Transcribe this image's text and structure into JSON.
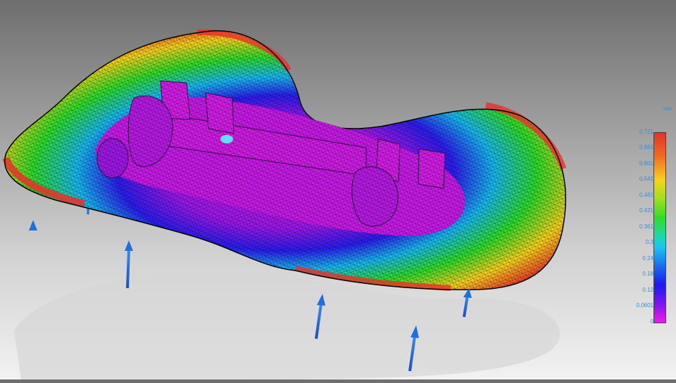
{
  "viewport": {
    "description_name": "fea-result-view",
    "colors": {
      "background_top": "#6e6e6e",
      "background_bottom": "#f2f2f2",
      "arrow": "#1f6fe0",
      "mesh": "#000000"
    }
  },
  "legend": {
    "unit": "mm",
    "ticks": [
      "0.721",
      "0.661",
      "0.601",
      "0.541",
      "0.481",
      "0.421",
      "0.361",
      "0.3",
      "0.24",
      "0.18",
      "0.12",
      "0.0601",
      "0"
    ],
    "colors": [
      "#e8302a",
      "#f7d21a",
      "#2fdc2a",
      "#17c8f0",
      "#1a1af0",
      "#f01ae6"
    ]
  }
}
